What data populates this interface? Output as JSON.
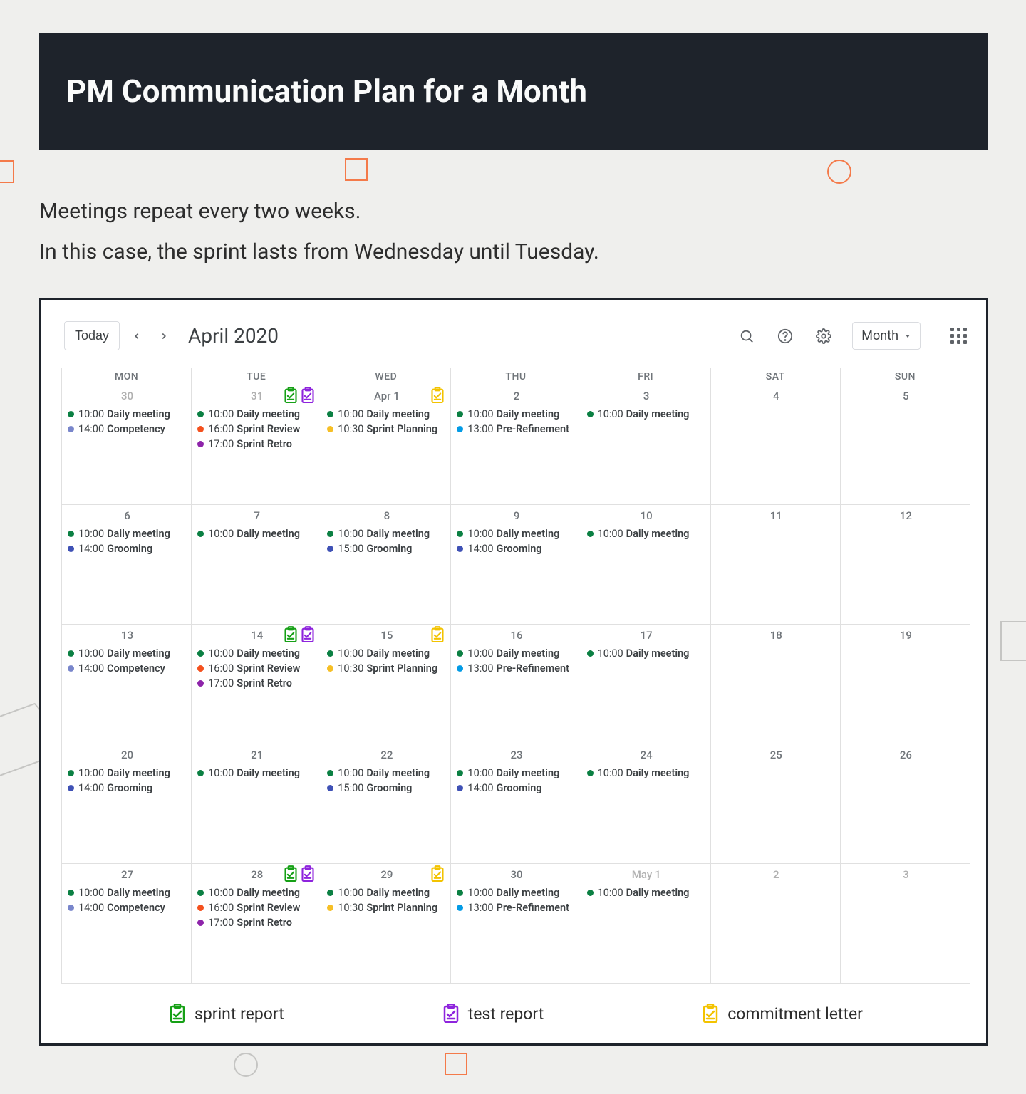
{
  "header": {
    "title": "PM Communication Plan for a Month"
  },
  "subtext": {
    "line1": "Meetings repeat every two weeks.",
    "line2": "In this case, the sprint lasts from Wednesday until Tuesday."
  },
  "colors": {
    "green": "#0b8043",
    "orange": "#f4511e",
    "purple": "#8e24aa",
    "yellow": "#f6bf26",
    "blue": "#3f51b5",
    "lblue": "#7986cb",
    "cyan": "#039be5"
  },
  "badge_colors": {
    "sprint_report": "#16a016",
    "test_report": "#8e24dd",
    "commitment_letter": "#f3c300"
  },
  "toolbar": {
    "today": "Today",
    "month_label": "April 2020",
    "view": "Month"
  },
  "day_headers": [
    "MON",
    "TUE",
    "WED",
    "THU",
    "FRI",
    "SAT",
    "SUN"
  ],
  "weeks": [
    [
      {
        "date": "30",
        "dim": true,
        "events": [
          {
            "c": "green",
            "t": "10:00",
            "n": "Daily meeting"
          },
          {
            "c": "lblue",
            "t": "14:00",
            "n": "Competency"
          }
        ]
      },
      {
        "date": "31",
        "dim": true,
        "badges": [
          "sprint_report",
          "test_report"
        ],
        "events": [
          {
            "c": "green",
            "t": "10:00",
            "n": "Daily meeting"
          },
          {
            "c": "orange",
            "t": "16:00",
            "n": "Sprint Review"
          },
          {
            "c": "purple",
            "t": "17:00",
            "n": "Sprint Retro"
          }
        ]
      },
      {
        "date": "Apr 1",
        "badges": [
          "commitment_letter"
        ],
        "events": [
          {
            "c": "green",
            "t": "10:00",
            "n": "Daily meeting"
          },
          {
            "c": "yellow",
            "t": "10:30",
            "n": "Sprint Planning"
          }
        ]
      },
      {
        "date": "2",
        "events": [
          {
            "c": "green",
            "t": "10:00",
            "n": "Daily meeting"
          },
          {
            "c": "cyan",
            "t": "13:00",
            "n": "Pre-Refinement"
          }
        ]
      },
      {
        "date": "3",
        "events": [
          {
            "c": "green",
            "t": "10:00",
            "n": "Daily meeting"
          }
        ]
      },
      {
        "date": "4",
        "events": []
      },
      {
        "date": "5",
        "events": []
      }
    ],
    [
      {
        "date": "6",
        "events": [
          {
            "c": "green",
            "t": "10:00",
            "n": "Daily meeting"
          },
          {
            "c": "blue",
            "t": "14:00",
            "n": "Grooming"
          }
        ]
      },
      {
        "date": "7",
        "events": [
          {
            "c": "green",
            "t": "10:00",
            "n": "Daily meeting"
          }
        ]
      },
      {
        "date": "8",
        "events": [
          {
            "c": "green",
            "t": "10:00",
            "n": "Daily meeting"
          },
          {
            "c": "blue",
            "t": "15:00",
            "n": "Grooming"
          }
        ]
      },
      {
        "date": "9",
        "events": [
          {
            "c": "green",
            "t": "10:00",
            "n": "Daily meeting"
          },
          {
            "c": "blue",
            "t": "14:00",
            "n": "Grooming"
          }
        ]
      },
      {
        "date": "10",
        "events": [
          {
            "c": "green",
            "t": "10:00",
            "n": "Daily meeting"
          }
        ]
      },
      {
        "date": "11",
        "events": []
      },
      {
        "date": "12",
        "events": []
      }
    ],
    [
      {
        "date": "13",
        "events": [
          {
            "c": "green",
            "t": "10:00",
            "n": "Daily meeting"
          },
          {
            "c": "lblue",
            "t": "14:00",
            "n": "Competency"
          }
        ]
      },
      {
        "date": "14",
        "badges": [
          "sprint_report",
          "test_report"
        ],
        "events": [
          {
            "c": "green",
            "t": "10:00",
            "n": "Daily meeting"
          },
          {
            "c": "orange",
            "t": "16:00",
            "n": "Sprint Review"
          },
          {
            "c": "purple",
            "t": "17:00",
            "n": "Sprint Retro"
          }
        ]
      },
      {
        "date": "15",
        "badges": [
          "commitment_letter"
        ],
        "events": [
          {
            "c": "green",
            "t": "10:00",
            "n": "Daily meeting"
          },
          {
            "c": "yellow",
            "t": "10:30",
            "n": "Sprint Planning"
          }
        ]
      },
      {
        "date": "16",
        "events": [
          {
            "c": "green",
            "t": "10:00",
            "n": "Daily meeting"
          },
          {
            "c": "cyan",
            "t": "13:00",
            "n": "Pre-Refinement"
          }
        ]
      },
      {
        "date": "17",
        "events": [
          {
            "c": "green",
            "t": "10:00",
            "n": "Daily meeting"
          }
        ]
      },
      {
        "date": "18",
        "events": []
      },
      {
        "date": "19",
        "events": []
      }
    ],
    [
      {
        "date": "20",
        "events": [
          {
            "c": "green",
            "t": "10:00",
            "n": "Daily meeting"
          },
          {
            "c": "blue",
            "t": "14:00",
            "n": "Grooming"
          }
        ]
      },
      {
        "date": "21",
        "events": [
          {
            "c": "green",
            "t": "10:00",
            "n": "Daily meeting"
          }
        ]
      },
      {
        "date": "22",
        "events": [
          {
            "c": "green",
            "t": "10:00",
            "n": "Daily meeting"
          },
          {
            "c": "blue",
            "t": "15:00",
            "n": "Grooming"
          }
        ]
      },
      {
        "date": "23",
        "events": [
          {
            "c": "green",
            "t": "10:00",
            "n": "Daily meeting"
          },
          {
            "c": "blue",
            "t": "14:00",
            "n": "Grooming"
          }
        ]
      },
      {
        "date": "24",
        "events": [
          {
            "c": "green",
            "t": "10:00",
            "n": "Daily meeting"
          }
        ]
      },
      {
        "date": "25",
        "events": []
      },
      {
        "date": "26",
        "events": []
      }
    ],
    [
      {
        "date": "27",
        "events": [
          {
            "c": "green",
            "t": "10:00",
            "n": "Daily meeting"
          },
          {
            "c": "lblue",
            "t": "14:00",
            "n": "Competency"
          }
        ]
      },
      {
        "date": "28",
        "badges": [
          "sprint_report",
          "test_report"
        ],
        "events": [
          {
            "c": "green",
            "t": "10:00",
            "n": "Daily meeting"
          },
          {
            "c": "orange",
            "t": "16:00",
            "n": "Sprint Review"
          },
          {
            "c": "purple",
            "t": "17:00",
            "n": "Sprint Retro"
          }
        ]
      },
      {
        "date": "29",
        "badges": [
          "commitment_letter"
        ],
        "events": [
          {
            "c": "green",
            "t": "10:00",
            "n": "Daily meeting"
          },
          {
            "c": "yellow",
            "t": "10:30",
            "n": "Sprint Planning"
          }
        ]
      },
      {
        "date": "30",
        "events": [
          {
            "c": "green",
            "t": "10:00",
            "n": "Daily meeting"
          },
          {
            "c": "cyan",
            "t": "13:00",
            "n": "Pre-Refinement"
          }
        ]
      },
      {
        "date": "May 1",
        "dim": true,
        "events": [
          {
            "c": "green",
            "t": "10:00",
            "n": "Daily meeting"
          }
        ]
      },
      {
        "date": "2",
        "dim": true,
        "events": []
      },
      {
        "date": "3",
        "dim": true,
        "events": []
      }
    ]
  ],
  "legend": {
    "sprint_report": "sprint report",
    "test_report": "test report",
    "commitment_letter": "commitment letter"
  }
}
